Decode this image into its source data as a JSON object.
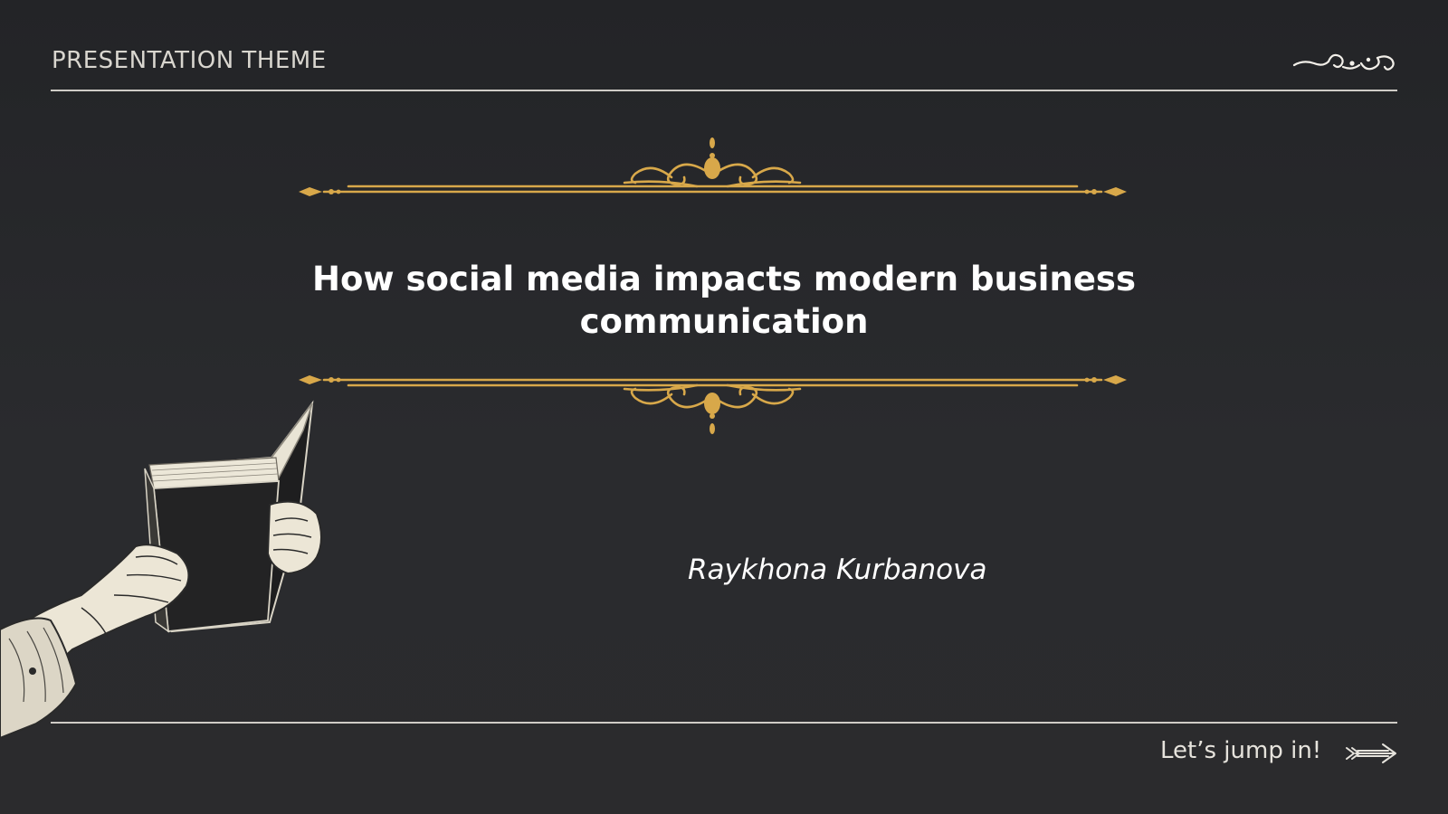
{
  "slide": {
    "header_label": "PRESENTATION THEME",
    "title": "How social media impacts modern business communication",
    "author": "Raykhona Kurbanova",
    "cta": "Let’s jump in!"
  },
  "colors": {
    "background": "#26272a",
    "gold": "#d8a84a",
    "rule": "#cfccc6",
    "text": "#ffffff"
  },
  "icons": {
    "corner": "flourish-icon",
    "cta": "arrow-right-icon",
    "ornament": "scroll-ornament-divider",
    "illustration": "hand-holding-book-illustration"
  }
}
